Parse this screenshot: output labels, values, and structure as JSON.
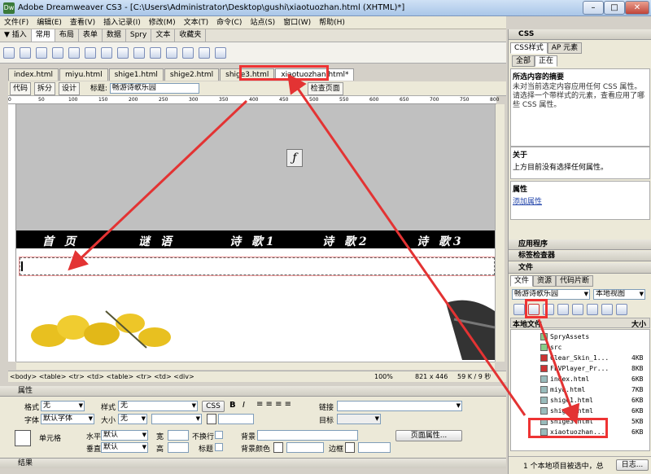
{
  "window": {
    "title": "Adobe Dreamweaver CS3 - [C:\\Users\\Administrator\\Desktop\\gushi\\xiaotuozhan.html (XHTML)*]",
    "minimize": "–",
    "maximize": "□",
    "close": "✕"
  },
  "menu": [
    "文件(F)",
    "编辑(E)",
    "查看(V)",
    "插入记录(I)",
    "修改(M)",
    "文本(T)",
    "命令(C)",
    "站点(S)",
    "窗口(W)",
    "帮助(H)"
  ],
  "insert_bar": {
    "label": "▼ 插入",
    "tabs": [
      "常用",
      "布局",
      "表单",
      "数据",
      "Spry",
      "文本",
      "收藏夹"
    ],
    "active": "常用"
  },
  "doc_tabs": [
    {
      "label": "index.html"
    },
    {
      "label": "miyu.html"
    },
    {
      "label": "shige1.html"
    },
    {
      "label": "shige2.html"
    },
    {
      "label": "shige3.html"
    },
    {
      "label": "xiaotuozhan.html*",
      "active": true
    }
  ],
  "doc_toolbar": {
    "code": "代码",
    "split": "拆分",
    "design": "设计",
    "title_label": "标题:",
    "title_value": "畅游诗歌乐园",
    "check_page": "检查页面"
  },
  "ruler_ticks": [
    "0",
    "50",
    "100",
    "150",
    "200",
    "250",
    "300",
    "350",
    "400",
    "450",
    "500",
    "550",
    "600",
    "650",
    "700",
    "750",
    "800"
  ],
  "nav_items": [
    "首 页",
    "谜 语",
    "诗 歌1",
    "诗 歌2",
    "诗 歌3"
  ],
  "status": {
    "tags": "<body> <table> <tr> <td> <table> <tr> <td> <div>",
    "zoom": "100%",
    "size": "821 x 446",
    "weight": "59 K / 9 秒"
  },
  "properties": {
    "header": "属性",
    "format_label": "格式",
    "format_value": "无",
    "style_label": "样式",
    "style_value": "无",
    "css_btn": "CSS",
    "link_label": "链接",
    "font_label": "字体",
    "font_value": "默认字体",
    "size_label": "大小",
    "size_value": "无",
    "target_label": "目标",
    "cell_label": "单元格",
    "horz_label": "水平",
    "horz_value": "默认",
    "width_label": "宽",
    "nowrap_label": "不换行",
    "bg_label": "背景",
    "page_props": "页面属性...",
    "vert_label": "垂直",
    "vert_value": "默认",
    "height_label": "高",
    "header_label": "标题",
    "bgcolor_label": "背景颜色",
    "border_label": "边框"
  },
  "results_bar": "结果",
  "right_panel": {
    "css_header": "CSS",
    "css_tabs": [
      "CSS样式",
      "AP 元素"
    ],
    "css_mode": [
      "全部",
      "正在"
    ],
    "summary_title": "所选内容的摘要",
    "summary_text": "未对当前选定内容应用任何 CSS 属性。请选择一个带样式的元素，查看应用了哪些 CSS 属性。",
    "about_title": "关于",
    "about_text": "上方目前没有选择任何属性。",
    "attr_title": "属性",
    "add_attr": "添加属性",
    "app_header": "应用程序",
    "tag_inspector": "标签检查器",
    "files_header": "文件",
    "files_tabs": [
      "文件",
      "资源",
      "代码片断"
    ],
    "site_name": "畅游诗歌乐园",
    "view_name": "本地视图",
    "col_local": "本地文件",
    "col_size": "大小",
    "files": [
      {
        "name": "SpryAssets",
        "size": "",
        "type": "folder"
      },
      {
        "name": "src",
        "size": "",
        "type": "folder"
      },
      {
        "name": "Clear_Skin_1...",
        "size": "4KB",
        "type": "swf"
      },
      {
        "name": "FLVPlayer_Pr...",
        "size": "8KB",
        "type": "swf"
      },
      {
        "name": "index.html",
        "size": "6KB",
        "type": "html"
      },
      {
        "name": "miyu.html",
        "size": "7KB",
        "type": "html"
      },
      {
        "name": "shige1.html",
        "size": "6KB",
        "type": "html"
      },
      {
        "name": "shige2.html",
        "size": "6KB",
        "type": "html"
      },
      {
        "name": "shige3.html",
        "size": "5KB",
        "type": "html"
      },
      {
        "name": "xiaotuozhan....",
        "size": "6KB",
        "type": "html"
      }
    ],
    "status_text": "1 个本地项目被选中，总",
    "log_btn": "日志..."
  },
  "colors": {
    "highlight": "#e33333",
    "navbar": "#000000",
    "banner": "#c0c0c0",
    "ginkgo": "#e8c020"
  }
}
